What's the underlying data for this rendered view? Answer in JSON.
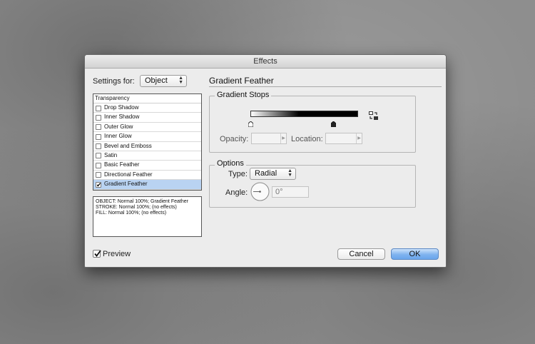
{
  "window": {
    "title": "Effects"
  },
  "settings_for": {
    "label": "Settings for:",
    "value": "Object"
  },
  "panel_title": "Gradient Feather",
  "effects_list": {
    "header": "Transparency",
    "items": [
      {
        "label": "Drop Shadow",
        "checked": false,
        "selected": false
      },
      {
        "label": "Inner Shadow",
        "checked": false,
        "selected": false
      },
      {
        "label": "Outer Glow",
        "checked": false,
        "selected": false
      },
      {
        "label": "Inner Glow",
        "checked": false,
        "selected": false
      },
      {
        "label": "Bevel and Emboss",
        "checked": false,
        "selected": false
      },
      {
        "label": "Satin",
        "checked": false,
        "selected": false
      },
      {
        "label": "Basic Feather",
        "checked": false,
        "selected": false
      },
      {
        "label": "Directional Feather",
        "checked": false,
        "selected": false
      },
      {
        "label": "Gradient Feather",
        "checked": true,
        "selected": true
      }
    ]
  },
  "summary": {
    "lines": [
      "OBJECT: Normal 100%; Gradient Feather",
      "STROKE: Normal 100%; (no effects)",
      "FILL: Normal 100%; (no effects)"
    ]
  },
  "gradient_stops": {
    "title": "Gradient Stops",
    "opacity_label": "Opacity:",
    "opacity_value": "",
    "location_label": "Location:",
    "location_value": ""
  },
  "options": {
    "title": "Options",
    "type_label": "Type:",
    "type_value": "Radial",
    "angle_label": "Angle:",
    "angle_value": "0°"
  },
  "preview": {
    "label": "Preview",
    "checked": true
  },
  "buttons": {
    "cancel": "Cancel",
    "ok": "OK"
  },
  "colors": {
    "ok_button": "#6aa6ec",
    "selected_row": "#b9d3f2",
    "dialog_bg": "#ececec"
  },
  "icons": {
    "reverse_gradient": "reverse-gradient-icon"
  }
}
